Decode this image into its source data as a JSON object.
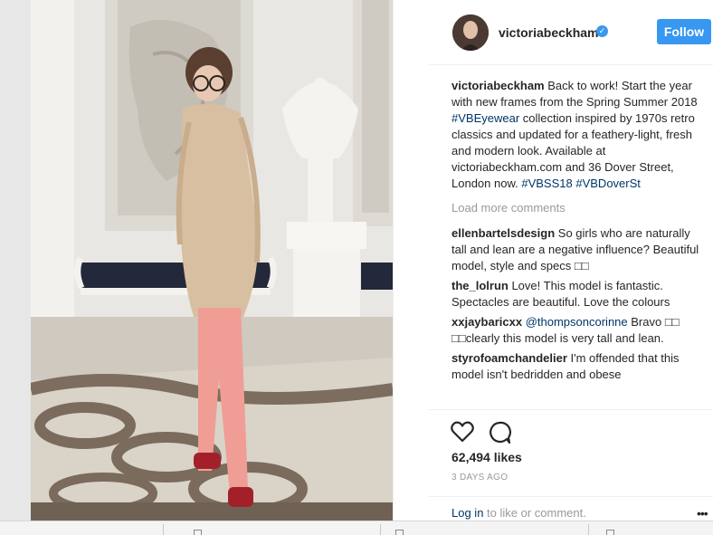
{
  "post": {
    "username": "victoriabeckham",
    "verified_icon": "verified-badge-icon",
    "follow_label": "Follow",
    "caption": {
      "username": "victoriabeckham",
      "text_1": " Back to work! Start the year with new frames from the Spring Summer 2018 ",
      "tag_1": "#VBEyewear",
      "text_2": " collection inspired by 1970s retro classics and updated for a feathery-light, fresh and modern look. Available at victoriabeckham.com and 36 Dover Street, London now. ",
      "tag_2": "#VBSS18",
      "text_3": " ",
      "tag_3": "#VBDoverSt"
    },
    "load_more": "Load more comments",
    "comments": [
      {
        "username": "ellenbartelsdesign",
        "text": " So girls who are naturally tall and lean are a negative influence? Beautiful model, style and specs □□"
      },
      {
        "username": "the_lolrun",
        "text": " Love! This model is fantastic. Spectacles are beautiful. Love the colours"
      },
      {
        "username": "xxjaybaricxx",
        "mention": "@thompsoncorinne",
        "text": " Bravo □□ □□clearly this model is very tall and lean."
      },
      {
        "username": "styrofoamchandelier",
        "text": " I'm offended that this model isn't bedridden and obese"
      }
    ],
    "likes": "62,494 likes",
    "date": "3 DAYS AGO",
    "login_link": "Log in",
    "login_rest": " to like or comment.",
    "more_label": "•••"
  },
  "icons": {
    "heart": "heart-icon",
    "comment": "comment-icon"
  },
  "colors": {
    "accent": "#3897f0",
    "link": "#003569",
    "muted": "#999999"
  }
}
